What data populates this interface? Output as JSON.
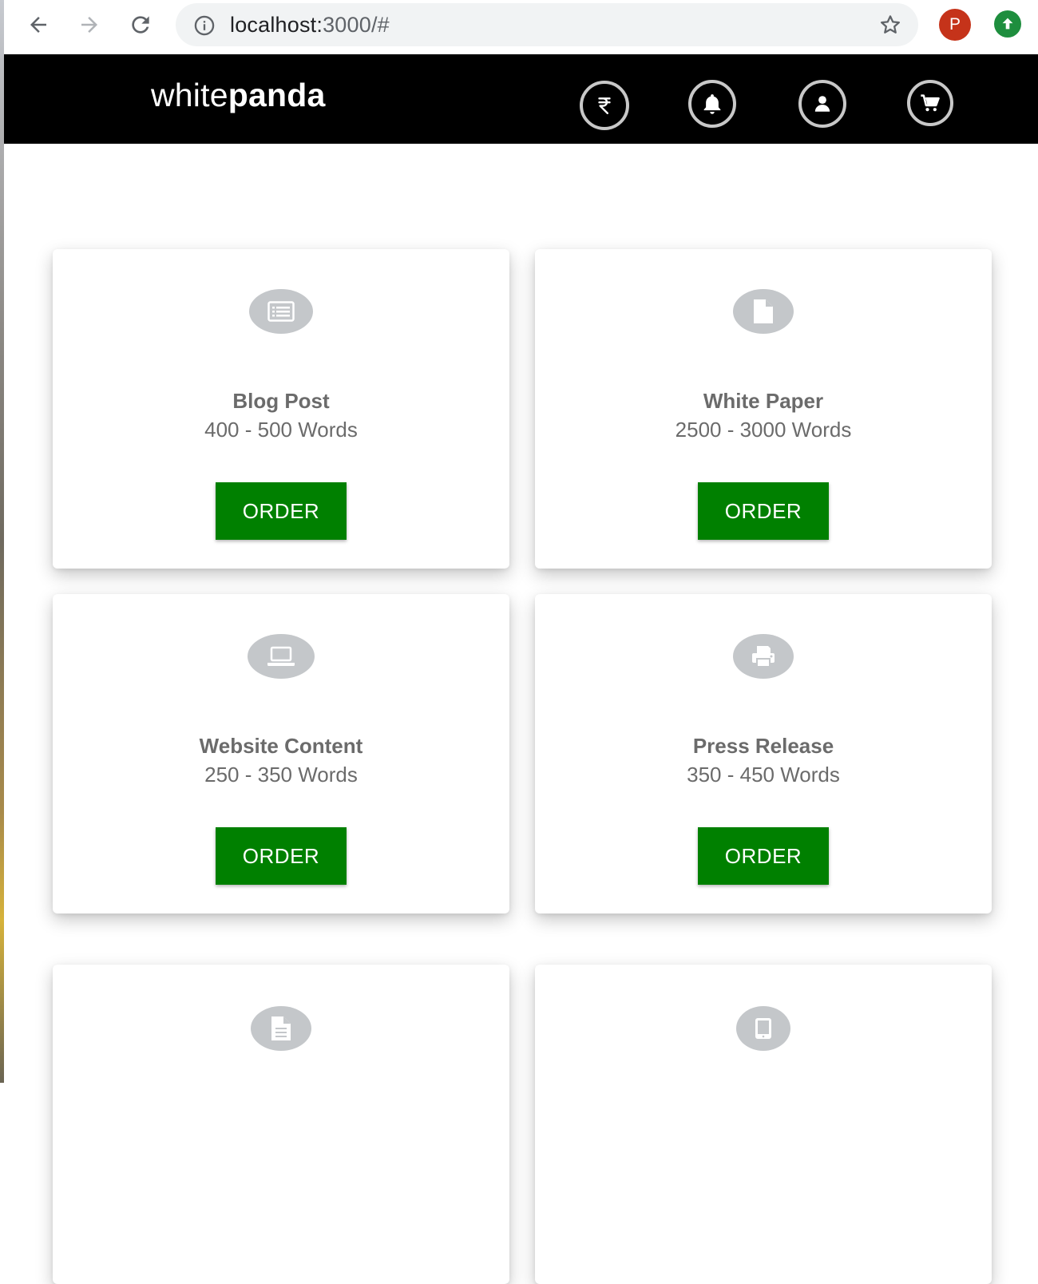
{
  "browser": {
    "url_host": "localhost:",
    "url_rest": "3000/#",
    "profile_initial": "P"
  },
  "header": {
    "brand_light": "white",
    "brand_bold": "panda",
    "icons": [
      "rupee-icon",
      "bell-icon",
      "user-icon",
      "cart-icon"
    ]
  },
  "cards": [
    {
      "title": "Blog Post",
      "subtitle": "400 - 500 Words",
      "button": "ORDER",
      "icon": "list-icon"
    },
    {
      "title": "White Paper",
      "subtitle": "2500 - 3000 Words",
      "button": "ORDER",
      "icon": "file-icon"
    },
    {
      "title": "Website Content",
      "subtitle": "250 - 350 Words",
      "button": "ORDER",
      "icon": "laptop-icon"
    },
    {
      "title": "Press Release",
      "subtitle": "350 - 450 Words",
      "button": "ORDER",
      "icon": "printer-icon"
    },
    {
      "icon": "document-text-icon"
    },
    {
      "icon": "tablet-icon"
    }
  ]
}
